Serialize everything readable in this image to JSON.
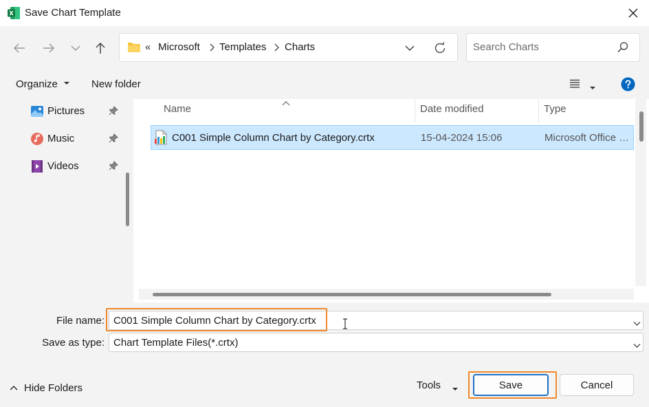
{
  "window": {
    "title": "Save Chart Template"
  },
  "address_bar": {
    "overflow_chevron": "«",
    "crumbs": [
      "Microsoft",
      "Templates",
      "Charts"
    ]
  },
  "search": {
    "placeholder": "Search Charts"
  },
  "command_bar": {
    "organize_label": "Organize",
    "new_folder_label": "New folder"
  },
  "nav_pane": {
    "items": [
      {
        "label": "Pictures",
        "icon": "pictures-icon"
      },
      {
        "label": "Music",
        "icon": "music-icon"
      },
      {
        "label": "Videos",
        "icon": "videos-icon"
      }
    ]
  },
  "file_list": {
    "columns": [
      "Name",
      "Date modified",
      "Type"
    ],
    "rows": [
      {
        "name": "C001 Simple Column Chart by Category.crtx",
        "date_modified": "15-04-2024 15:06",
        "type": "Microsoft Office C..."
      }
    ]
  },
  "form": {
    "file_name_label": "File name:",
    "file_name_value": "C001 Simple Column Chart by Category.crtx",
    "save_as_type_label": "Save as type:",
    "save_as_type_value": "Chart Template Files(*.crtx)"
  },
  "footer": {
    "hide_folders_label": "Hide Folders",
    "tools_label": "Tools",
    "save_label": "Save",
    "cancel_label": "Cancel"
  },
  "colors": {
    "accent": "#1f6fc5",
    "selection": "#cce8ff",
    "highlight": "#f0882c",
    "help": "#0067c0"
  }
}
